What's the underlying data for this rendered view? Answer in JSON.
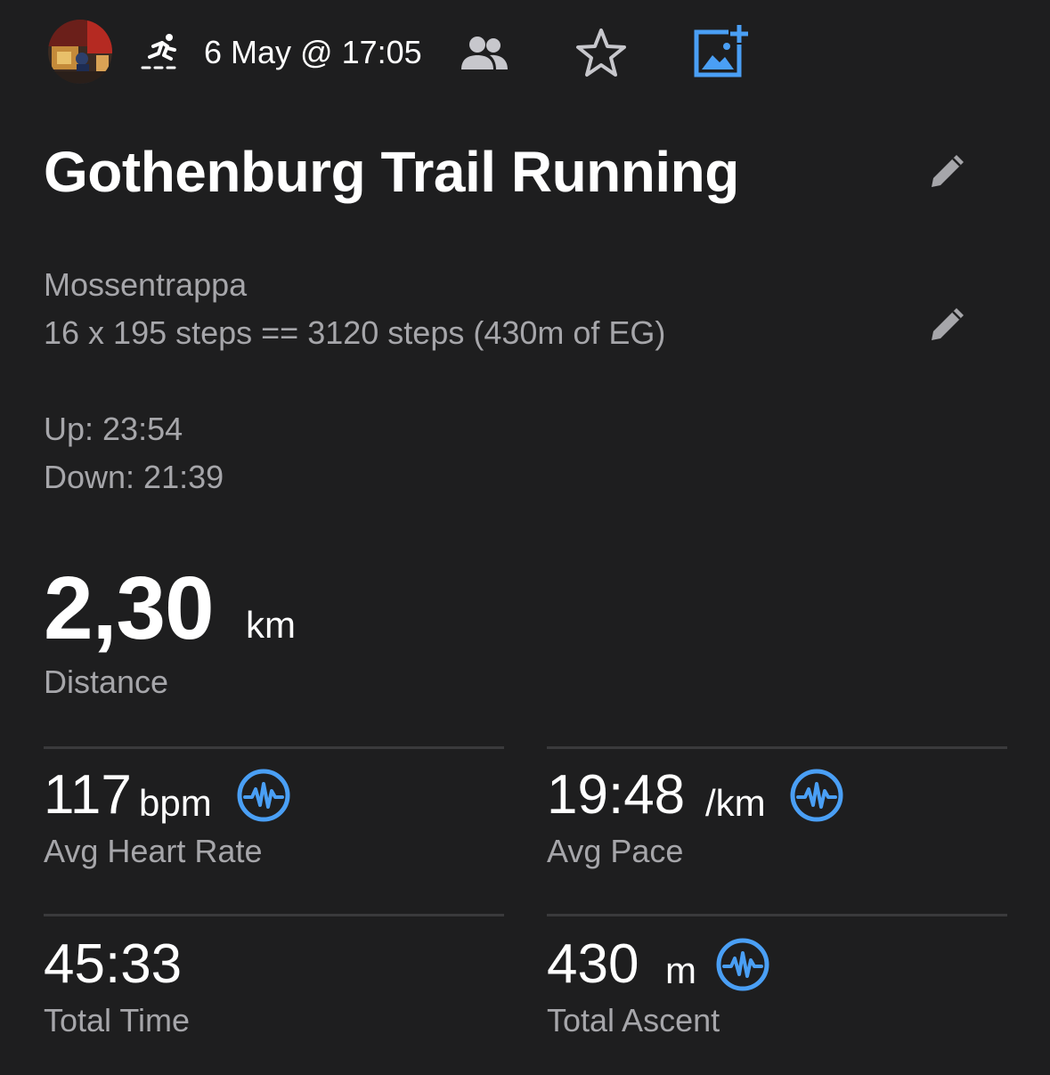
{
  "header": {
    "activity_icon": "running-person-icon",
    "date": "6 May @ 17:05",
    "people_icon": "people-icon",
    "favorite_icon": "star-outline-icon",
    "add_photo_icon": "add-photo-icon",
    "accent_color": "#4a9ff5"
  },
  "activity": {
    "title": "Gothenburg Trail Running",
    "description_lines": [
      "Mossentrappa",
      "16 x 195 steps == 3120 steps (430m of EG)",
      "",
      "Up: 23:54",
      "Down: 21:39"
    ]
  },
  "distance": {
    "value": "2,30",
    "unit": "km",
    "label": "Distance"
  },
  "stats": [
    {
      "value": "117",
      "unit": "bpm",
      "label": "Avg Heart Rate",
      "has_chart_icon": true
    },
    {
      "value": "19:48",
      "unit": "/km",
      "label": "Avg Pace",
      "has_chart_icon": true
    },
    {
      "value": "45:33",
      "unit": "",
      "label": "Total Time",
      "has_chart_icon": false
    },
    {
      "value": "430",
      "unit": "m",
      "label": "Total Ascent",
      "has_chart_icon": true
    }
  ]
}
